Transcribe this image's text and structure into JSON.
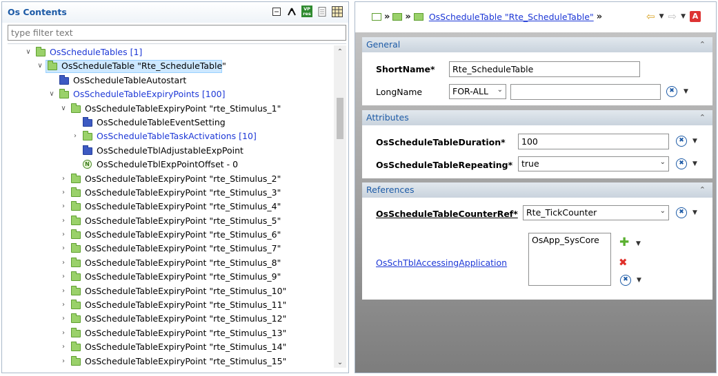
{
  "left_panel": {
    "title": "Os Contents",
    "filter_placeholder": "type filter text",
    "toolbar_icons": [
      "collapse-all-icon",
      "link-icon",
      "vp-res-icon",
      "document-icon",
      "table-icon"
    ],
    "vp_icon_text": "VP res"
  },
  "tree": [
    {
      "label": "OsScheduleTables [1]",
      "indent": 1,
      "twisty": "expanded",
      "icon": "folder",
      "blue": true
    },
    {
      "label": "OsScheduleTable \"Rte_ScheduleTable\"",
      "indent": 2,
      "twisty": "expanded",
      "icon": "folder",
      "selected": true
    },
    {
      "label": "OsScheduleTableAutostart",
      "indent": 3,
      "twisty": "none",
      "icon": "blue"
    },
    {
      "label": "OsScheduleTableExpiryPoints [100]",
      "indent": 3,
      "twisty": "expanded",
      "icon": "folder",
      "blue": true
    },
    {
      "label": "OsScheduleTableExpiryPoint \"rte_Stimulus_1\"",
      "indent": 4,
      "twisty": "expanded",
      "icon": "folder"
    },
    {
      "label": "OsScheduleTableEventSetting",
      "indent": 5,
      "twisty": "none",
      "icon": "blue"
    },
    {
      "label": "OsScheduleTableTaskActivations [10]",
      "indent": 5,
      "twisty": "collapsed",
      "icon": "folder",
      "blue": true
    },
    {
      "label": "OsScheduleTblAdjustableExpPoint",
      "indent": 5,
      "twisty": "none",
      "icon": "blue"
    },
    {
      "label": "OsScheduleTblExpPointOffset - 0",
      "indent": 5,
      "twisty": "none",
      "icon": "n"
    },
    {
      "label": "OsScheduleTableExpiryPoint \"rte_Stimulus_2\"",
      "indent": 4,
      "twisty": "collapsed",
      "icon": "folder"
    },
    {
      "label": "OsScheduleTableExpiryPoint \"rte_Stimulus_3\"",
      "indent": 4,
      "twisty": "collapsed",
      "icon": "folder"
    },
    {
      "label": "OsScheduleTableExpiryPoint \"rte_Stimulus_4\"",
      "indent": 4,
      "twisty": "collapsed",
      "icon": "folder"
    },
    {
      "label": "OsScheduleTableExpiryPoint \"rte_Stimulus_5\"",
      "indent": 4,
      "twisty": "collapsed",
      "icon": "folder"
    },
    {
      "label": "OsScheduleTableExpiryPoint \"rte_Stimulus_6\"",
      "indent": 4,
      "twisty": "collapsed",
      "icon": "folder"
    },
    {
      "label": "OsScheduleTableExpiryPoint \"rte_Stimulus_7\"",
      "indent": 4,
      "twisty": "collapsed",
      "icon": "folder"
    },
    {
      "label": "OsScheduleTableExpiryPoint \"rte_Stimulus_8\"",
      "indent": 4,
      "twisty": "collapsed",
      "icon": "folder"
    },
    {
      "label": "OsScheduleTableExpiryPoint \"rte_Stimulus_9\"",
      "indent": 4,
      "twisty": "collapsed",
      "icon": "folder"
    },
    {
      "label": "OsScheduleTableExpiryPoint \"rte_Stimulus_10\"",
      "indent": 4,
      "twisty": "collapsed",
      "icon": "folder"
    },
    {
      "label": "OsScheduleTableExpiryPoint \"rte_Stimulus_11\"",
      "indent": 4,
      "twisty": "collapsed",
      "icon": "folder"
    },
    {
      "label": "OsScheduleTableExpiryPoint \"rte_Stimulus_12\"",
      "indent": 4,
      "twisty": "collapsed",
      "icon": "folder"
    },
    {
      "label": "OsScheduleTableExpiryPoint \"rte_Stimulus_13\"",
      "indent": 4,
      "twisty": "collapsed",
      "icon": "folder"
    },
    {
      "label": "OsScheduleTableExpiryPoint \"rte_Stimulus_14\"",
      "indent": 4,
      "twisty": "collapsed",
      "icon": "folder"
    },
    {
      "label": "OsScheduleTableExpiryPoint \"rte_Stimulus_15\"",
      "indent": 4,
      "twisty": "collapsed",
      "icon": "folder"
    }
  ],
  "editor": {
    "breadcrumb_link": "OsScheduleTable \"Rte_ScheduleTable\"",
    "a_icon_text": "A",
    "general": {
      "title": "General",
      "shortname_label": "ShortName*",
      "shortname_value": "Rte_ScheduleTable",
      "longname_label": "LongName",
      "longname_lang": "FOR-ALL",
      "longname_value": ""
    },
    "attributes": {
      "title": "Attributes",
      "duration_label": "OsScheduleTableDuration*",
      "duration_value": "100",
      "repeating_label": "OsScheduleTableRepeating*",
      "repeating_value": "true"
    },
    "references": {
      "title": "References",
      "counter_label": "OsScheduleTableCounterRef*",
      "counter_value": "Rte_TickCounter",
      "accessing_label": "OsSchTblAccessingApplication",
      "accessing_items": [
        "OsApp_SysCore"
      ]
    }
  }
}
